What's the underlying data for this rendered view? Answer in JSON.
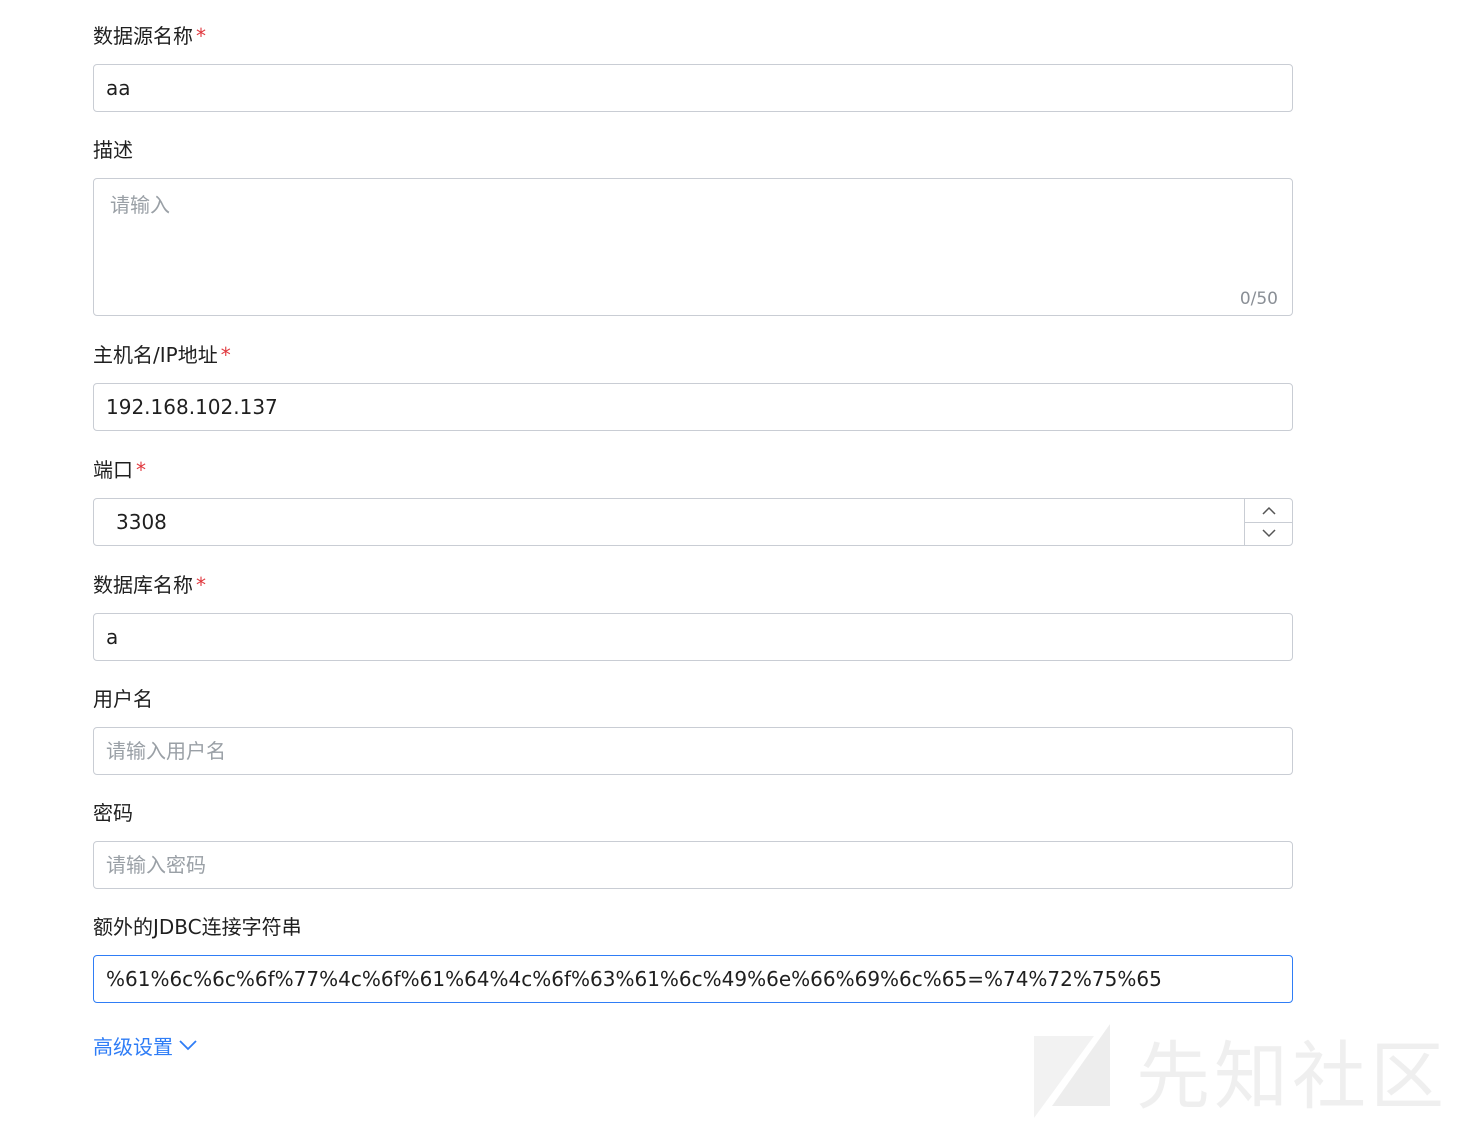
{
  "fields": {
    "datasource_name": {
      "label": "数据源名称",
      "required_mark": "*",
      "value": "aa"
    },
    "description": {
      "label": "描述",
      "placeholder": "请输入",
      "counter": "0/50"
    },
    "host": {
      "label": "主机名/IP地址",
      "required_mark": "*",
      "value": "192.168.102.137"
    },
    "port": {
      "label": "端口",
      "required_mark": "*",
      "value": "3308"
    },
    "database_name": {
      "label": "数据库名称",
      "required_mark": "*",
      "value": "a"
    },
    "username": {
      "label": "用户名",
      "placeholder": "请输入用户名"
    },
    "password": {
      "label": "密码",
      "placeholder": "请输入密码"
    },
    "jdbc": {
      "label": "额外的JDBC连接字符串",
      "value": "%61%6c%6c%6f%77%4c%6f%61%64%4c%6f%63%61%6c%49%6e%66%69%6c%65=%74%72%75%65"
    }
  },
  "advanced": {
    "label": "高级设置",
    "icon": "chevron-down-icon"
  },
  "watermark": {
    "text": "先知社区"
  },
  "colors": {
    "accent": "#2f7df6",
    "required": "#e0383e",
    "border": "#c9cdd4"
  }
}
